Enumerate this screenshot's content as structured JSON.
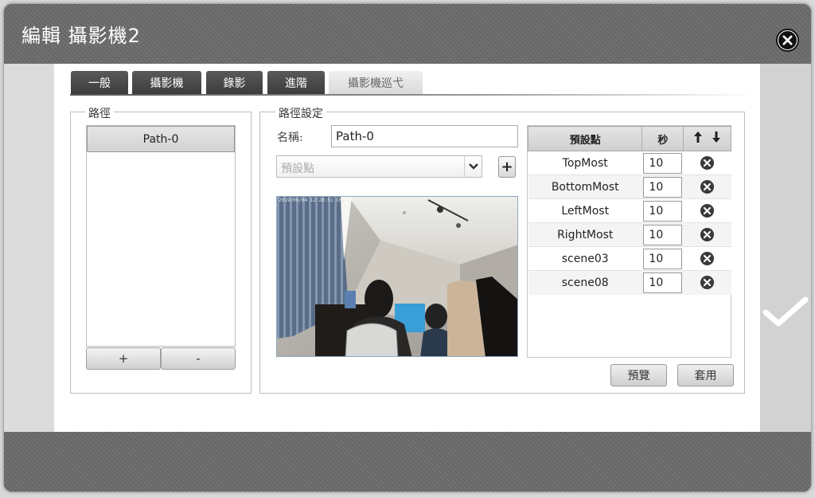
{
  "dialog": {
    "title": "編輯 攝影機2"
  },
  "tabs": [
    {
      "label": "一般",
      "active": false
    },
    {
      "label": "攝影機",
      "active": false
    },
    {
      "label": "錄影",
      "active": false
    },
    {
      "label": "進階",
      "active": false
    },
    {
      "label": "攝影機巡弋",
      "active": true
    }
  ],
  "path_group": {
    "legend": "路徑",
    "items": [
      "Path-0"
    ],
    "add_label": "+",
    "remove_label": "-"
  },
  "path_settings": {
    "legend": "路徑設定",
    "name_label": "名稱:",
    "name_value": "Path-0",
    "preset_placeholder": "預設點",
    "add_preset_label": "+",
    "camera_timestamp": "2019/06/04 12:28:51 CH2"
  },
  "preset_table": {
    "headers": {
      "preset": "預設點",
      "seconds": "秒",
      "order_icons": [
        "arrow-up-icon",
        "arrow-down-icon"
      ]
    },
    "rows": [
      {
        "name": "TopMost",
        "seconds": "10"
      },
      {
        "name": "BottomMost",
        "seconds": "10"
      },
      {
        "name": "LeftMost",
        "seconds": "10"
      },
      {
        "name": "RightMost",
        "seconds": "10"
      },
      {
        "name": "scene03",
        "seconds": "10"
      },
      {
        "name": "scene08",
        "seconds": "10"
      }
    ]
  },
  "actions": {
    "preview": "預覽",
    "apply": "套用"
  },
  "icons": {
    "close": "close-icon",
    "confirm": "checkmark-icon",
    "delete": "remove-circle-icon",
    "dropdown": "chevron-down-icon"
  },
  "colors": {
    "title_bar": "#6b6b6b",
    "active_tab": "#e8e8e8",
    "inactive_tab": "#474747"
  }
}
